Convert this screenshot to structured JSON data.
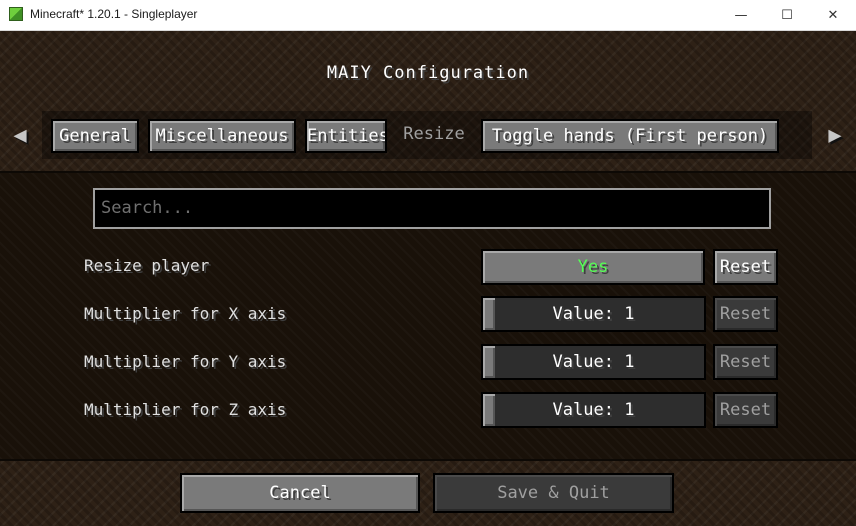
{
  "window": {
    "title": "Minecraft* 1.20.1 - Singleplayer",
    "controls": {
      "minimize": "—",
      "maximize": "☐",
      "close": "✕"
    }
  },
  "screen": {
    "title": "MAIY Configuration",
    "nav": {
      "prev": "◀",
      "next": "▶"
    },
    "tabs": [
      {
        "label": "General"
      },
      {
        "label": "Miscellaneous"
      },
      {
        "label": "Entities"
      },
      {
        "label": "Resize",
        "selected": true
      },
      {
        "label": "Toggle hands (First person)"
      }
    ]
  },
  "search": {
    "placeholder": "Search..."
  },
  "options": [
    {
      "label": "Resize player",
      "value": "Yes",
      "reset": "Reset"
    },
    {
      "label": "Multiplier for X axis",
      "value": "Value: 1",
      "reset": "Reset"
    },
    {
      "label": "Multiplier for Y axis",
      "value": "Value: 1",
      "reset": "Reset"
    },
    {
      "label": "Multiplier for Z axis",
      "value": "Value: 1",
      "reset": "Reset"
    }
  ],
  "footer": {
    "cancel": "Cancel",
    "save": "Save & Quit"
  },
  "colors": {
    "toggle_on": "#55ff55",
    "disabled_text": "#a0a0a0"
  }
}
